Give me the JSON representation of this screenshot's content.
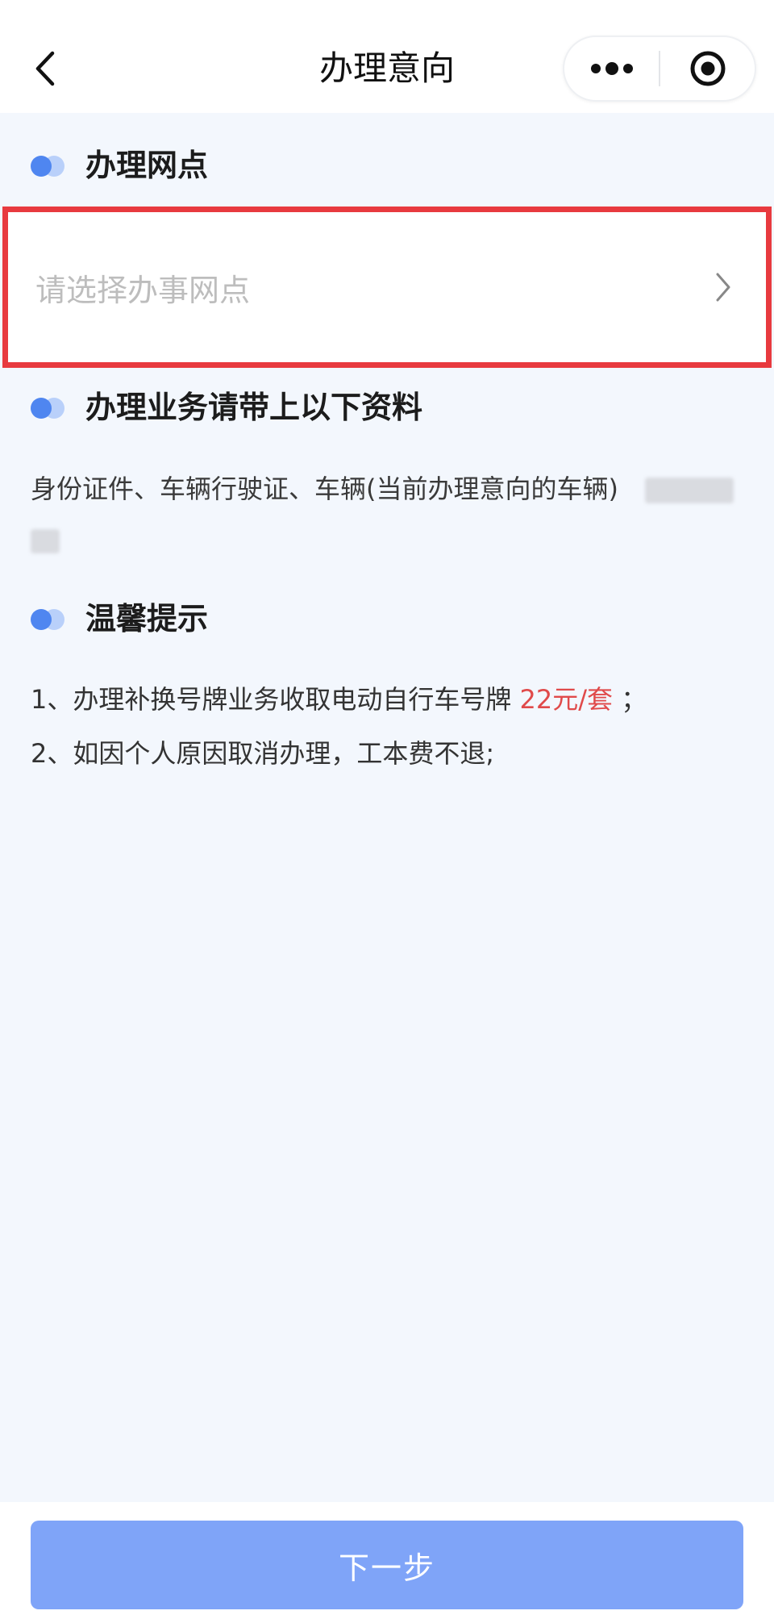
{
  "header": {
    "title": "办理意向",
    "back_icon": "chevron-left-icon",
    "more_icon": "more-dots-icon",
    "close_icon": "target-close-icon"
  },
  "sections": {
    "outlet": {
      "title": "办理网点",
      "select_placeholder": "请选择办事网点"
    },
    "materials": {
      "title": "办理业务请带上以下资料",
      "text": "身份证件、车辆行驶证、车辆(当前办理意向的车辆)"
    },
    "tips": {
      "title": "温馨提示",
      "line1_prefix": "1、办理补换号牌业务收取电动自行车号牌",
      "line1_price": "22元/套",
      "line1_suffix": "；",
      "line2": "2、如因个人原因取消办理，工本费不退;"
    }
  },
  "footer": {
    "next_label": "下一步"
  },
  "colors": {
    "accent_blue": "#4f86f0",
    "button_blue": "#7fa4f8",
    "highlight_red": "#e83a3f",
    "price_red": "#e04a4a",
    "background": "#f3f7fd"
  }
}
